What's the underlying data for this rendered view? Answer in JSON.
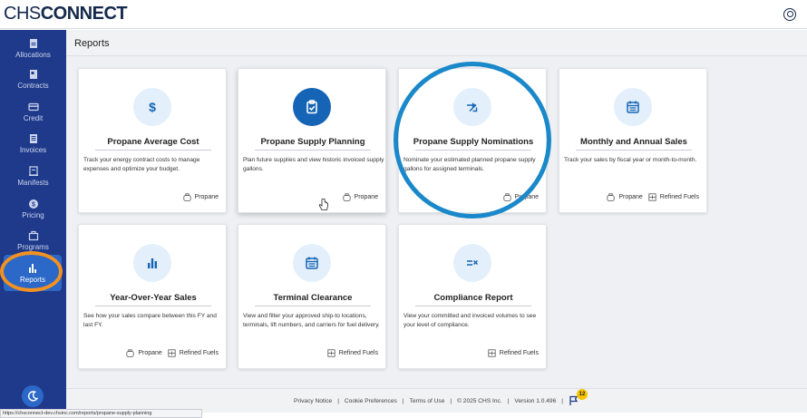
{
  "app": {
    "logo_part1": "CHS",
    "logo_part2": "CONNECT"
  },
  "sidebar": {
    "items": [
      {
        "label": "Allocations",
        "icon": "allocations-icon"
      },
      {
        "label": "Contracts",
        "icon": "contracts-icon"
      },
      {
        "label": "Credit",
        "icon": "credit-card-icon"
      },
      {
        "label": "Invoices",
        "icon": "invoices-icon"
      },
      {
        "label": "Manifests",
        "icon": "manifests-icon"
      },
      {
        "label": "Pricing",
        "icon": "pricing-icon"
      },
      {
        "label": "Programs",
        "icon": "programs-icon"
      },
      {
        "label": "Reports",
        "icon": "reports-icon",
        "active": true
      }
    ]
  },
  "page": {
    "title": "Reports"
  },
  "cards": [
    {
      "title": "Propane Average Cost",
      "icon": "dollar-icon",
      "desc": "Track your energy contract costs to manage expenses and optimize your budget.",
      "tags": [
        "Propane"
      ]
    },
    {
      "title": "Propane Supply Planning",
      "icon": "clipboard-check-icon",
      "desc": "Plan future supplies and view historic invoiced supply gallons.",
      "tags": [
        "Propane"
      ]
    },
    {
      "title": "Propane Supply Nominations",
      "icon": "shuffle-arrows-icon",
      "desc": "Nominate your estimated planned propane supply gallons for assigned terminals.",
      "tags": [
        "Propane"
      ]
    },
    {
      "title": "Monthly and Annual Sales",
      "icon": "calendar-icon",
      "desc": "Track your sales by fiscal year or month-to-month.",
      "tags": [
        "Propane",
        "Refined Fuels"
      ]
    },
    {
      "title": "Year-Over-Year Sales",
      "icon": "bar-chart-icon",
      "desc": "See how your sales compare between this FY and last FY.",
      "tags": [
        "Propane",
        "Refined Fuels"
      ]
    },
    {
      "title": "Terminal Clearance",
      "icon": "calendar-icon",
      "desc": "View and filter your approved ship-to locations, terminals, lift numbers, and carriers for fuel delivery.",
      "tags": [
        "Refined Fuels"
      ]
    },
    {
      "title": "Compliance Report",
      "icon": "equals-check-icon",
      "desc": "View your committed and invoiced volumes to see your level of compliance.",
      "tags": [
        "Refined Fuels"
      ]
    }
  ],
  "footer": {
    "privacy": "Privacy Notice",
    "cookies": "Cookie Preferences",
    "terms": "Terms of Use",
    "copyright": "© 2025 CHS Inc.",
    "version": "Version 1.0.496",
    "sep": "|",
    "notification_count": "12"
  },
  "status_url": "https://chsconnect-dev.chsinc.com/reports/propane-supply-planning",
  "colors": {
    "sidebar": "#1f3a8b",
    "accent": "#1664b6",
    "highlight_blue": "#1a88c9",
    "highlight_orange": "#f39122",
    "badge": "#f6c500"
  }
}
